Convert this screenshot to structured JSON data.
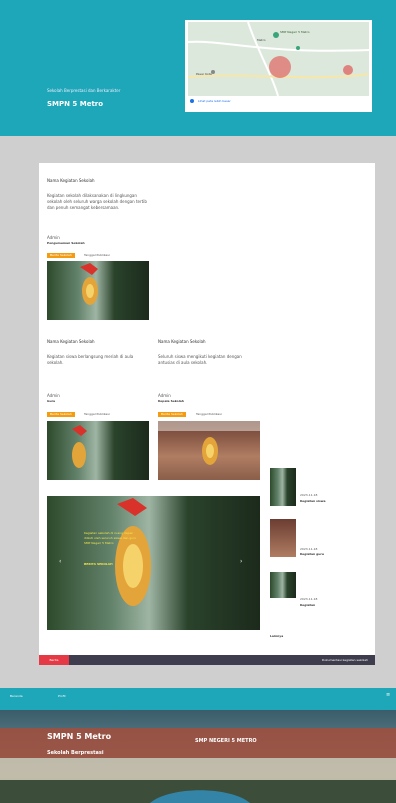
{
  "header": {
    "site_name": "SMPN 5 Metro",
    "tagline": "Sekolah Berprestasi dan Berkarakter",
    "map_footer_link": "Lihat peta lebih besar",
    "map_labels": [
      "SMP Negeri 5 Metro",
      "Metro",
      "Pasar Kota"
    ]
  },
  "posts": [
    {
      "title": "Nama Kegiatan Sekolah",
      "excerpt": "Kegiatan sekolah dilaksanakan di lingkungan sekolah oleh seluruh warga sekolah dengan tertib dan penuh semangat kebersamaan.",
      "author": "Admin",
      "date": "Pengumuman Sekolah",
      "category": "Berita Sekolah",
      "meta": "Tanggal Publikasi"
    },
    {
      "title": "Nama Kegiatan Sekolah",
      "excerpt": "Kegiatan siswa berlangsung meriah di aula sekolah.",
      "author": "Admin",
      "date": "Guru",
      "category": "Berita Sekolah",
      "meta": "Tanggal Publikasi"
    },
    {
      "title": "Nama Kegiatan Sekolah",
      "excerpt": "Seluruh siswa mengikuti kegiatan dengan antusias di aula sekolah.",
      "author": "Admin",
      "date": "Kepala Sekolah",
      "category": "Berita Sekolah",
      "meta": "Tanggal Publikasi"
    }
  ],
  "featured": {
    "overlay_lines": [
      "Kegiatan sekolah di ruang depan",
      "diikuti oleh seluruh siswa dan guru",
      "SMP Negeri 5 Metro"
    ],
    "caption": "BERITA SEKOLAH"
  },
  "sidebar": [
    {
      "date": "2023-11-18",
      "title": "Kegiatan siswa"
    },
    {
      "date": "2023-11-18",
      "title": "Kegiatan guru"
    },
    {
      "date": "2023-11-18",
      "title": "Kegiatan"
    }
  ],
  "sidebar_footer": "Lainnya",
  "footer_bar": {
    "badge": "Berita",
    "text": "Dokumentasi kegiatan sekolah"
  },
  "bottom_nav": {
    "items": [
      "Beranda",
      "Profil"
    ]
  },
  "banner": {
    "title": "SMPN 5 Metro",
    "subtitle": "Sekolah Berprestasi",
    "sign": "SMP NEGERI 5 METRO"
  },
  "colors": {
    "primary": "#1da7b8",
    "accent": "#f39c12",
    "footer": "#3d3d4d",
    "badge": "#e53945"
  }
}
